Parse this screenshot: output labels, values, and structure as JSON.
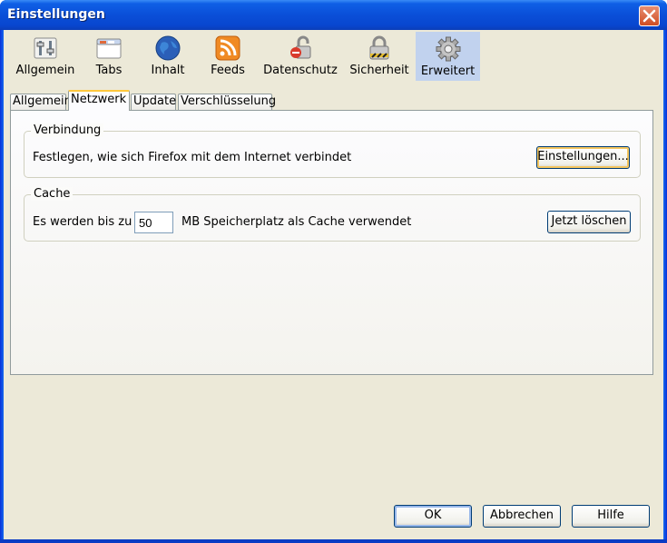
{
  "window": {
    "title": "Einstellungen"
  },
  "toolbar": {
    "items": [
      {
        "label": "Allgemein",
        "icon": "general-switches-icon"
      },
      {
        "label": "Tabs",
        "icon": "tabs-window-icon"
      },
      {
        "label": "Inhalt",
        "icon": "globe-icon"
      },
      {
        "label": "Feeds",
        "icon": "rss-feed-icon"
      },
      {
        "label": "Datenschutz",
        "icon": "privacy-lock-icon"
      },
      {
        "label": "Sicherheit",
        "icon": "security-padlock-icon"
      },
      {
        "label": "Erweitert",
        "icon": "gear-icon",
        "selected": true
      }
    ]
  },
  "tabs": [
    "Allgemein",
    "Netzwerk",
    "Update",
    "Verschlüsselung"
  ],
  "active_tab": "Netzwerk",
  "connection": {
    "legend": "Verbindung",
    "description": "Festlegen, wie sich Firefox mit dem Internet verbindet",
    "settings_button": "Einstellungen..."
  },
  "cache": {
    "legend": "Cache",
    "prefix": "Es werden bis zu",
    "value": "50",
    "suffix": "MB Speicherplatz als Cache verwendet",
    "clear_button": "Jetzt löschen"
  },
  "footer": {
    "ok": "OK",
    "cancel": "Abbrechen",
    "help": "Hilfe"
  },
  "colors": {
    "titlebar": "#0a4fd8",
    "face": "#ece9d8",
    "selected_toolbar": "#c1d2ee",
    "close": "#cf4d23",
    "tab_highlight": "#ffc83c"
  }
}
